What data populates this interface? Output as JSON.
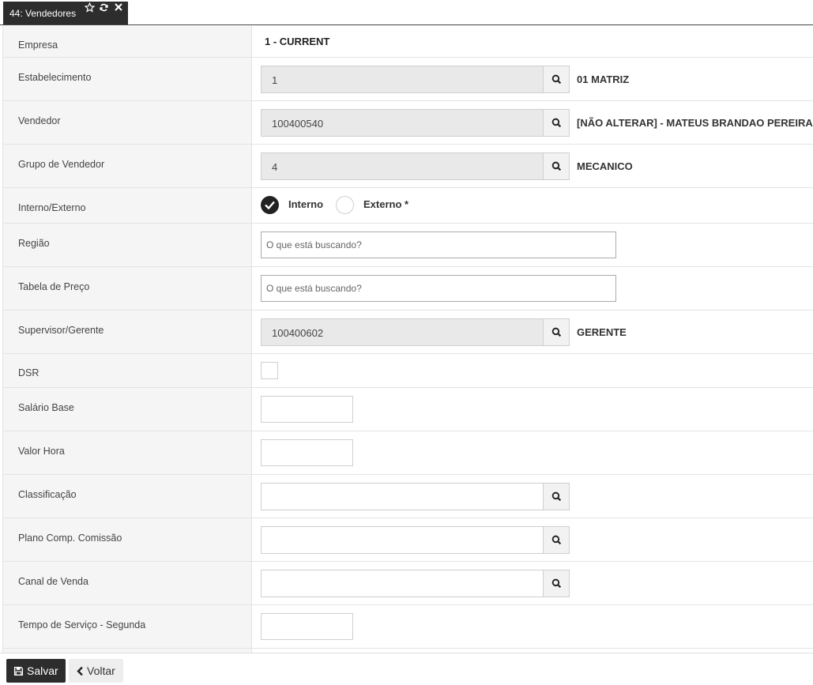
{
  "tab": {
    "title": "44: Vendedores",
    "icons": [
      "star-icon",
      "refresh-icon",
      "close-icon"
    ]
  },
  "form": {
    "empresa": {
      "label": "Empresa",
      "value": "1 - CURRENT"
    },
    "estabelecimento": {
      "label": "Estabelecimento",
      "value": "1",
      "description": "01 MATRIZ"
    },
    "vendedor": {
      "label": "Vendedor",
      "value": "100400540",
      "description": "[NÃO ALTERAR] - MATEUS BRANDAO PEREIRA"
    },
    "grupo_vendedor": {
      "label": "Grupo de Vendedor",
      "value": "4",
      "description": "MECANICO"
    },
    "interno_externo": {
      "label": "Interno/Externo",
      "option_interno": "Interno",
      "option_externo": "Externo *",
      "selected": "Interno"
    },
    "regiao": {
      "label": "Região",
      "placeholder": "O que está buscando?"
    },
    "tabela_preco": {
      "label": "Tabela de Preço",
      "placeholder": "O que está buscando?"
    },
    "supervisor": {
      "label": "Supervisor/Gerente",
      "value": "100400602",
      "description": "GERENTE"
    },
    "dsr": {
      "label": "DSR",
      "checked": false
    },
    "salario_base": {
      "label": "Salário Base",
      "value": ""
    },
    "valor_hora": {
      "label": "Valor Hora",
      "value": ""
    },
    "classificacao": {
      "label": "Classificação",
      "value": ""
    },
    "plano_comissao": {
      "label": "Plano Comp. Comissão",
      "value": ""
    },
    "canal_venda": {
      "label": "Canal de Venda",
      "value": ""
    },
    "tempo_servico_segunda": {
      "label": "Tempo de Serviço - Segunda",
      "value": ""
    }
  },
  "footer": {
    "save_label": "Salvar",
    "back_label": "Voltar"
  }
}
